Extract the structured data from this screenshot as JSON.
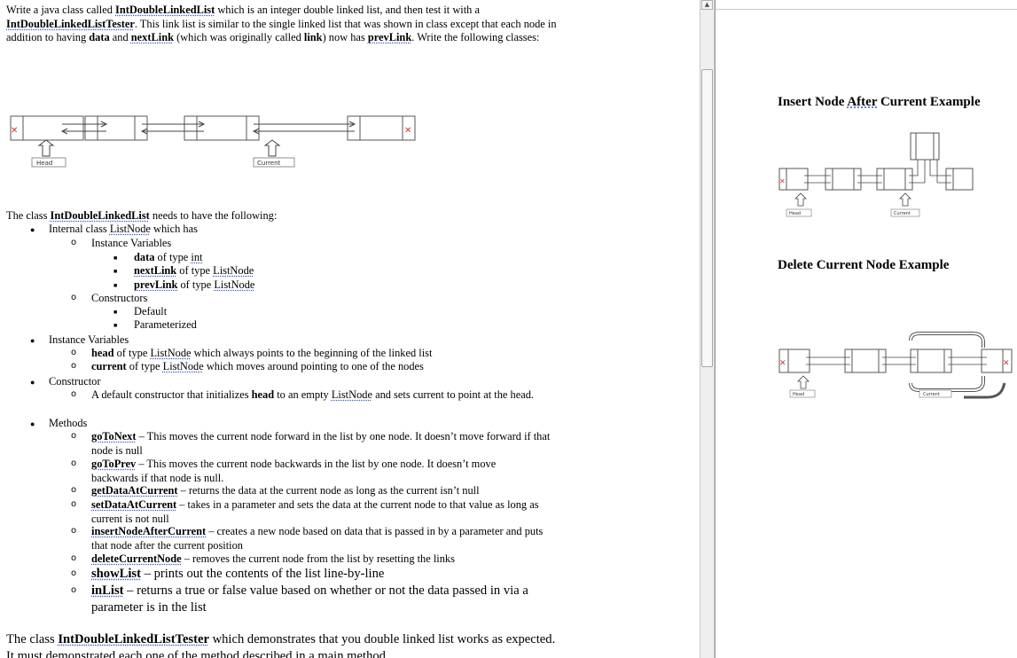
{
  "intro": {
    "part1": "Write a java class called ",
    "class1": "IntDoubleLinkedList",
    "part2": " which is an integer double linked list, and then test it with a ",
    "class2": "IntDoubleLinkedListTester",
    "part3": ".  This link list is similar to the single linked list that was shown in class except that each node in addition to having ",
    "data_word": "data",
    "and_word": " and ",
    "next_word": "nextLink",
    "part4": " (which was originally called ",
    "link_word": "link",
    "part5": ") now has ",
    "prev_word": "prevLink",
    "part6": ".  Write the following classes:"
  },
  "diagram_main": {
    "head_label": "Head",
    "current_label": "Current"
  },
  "section1": {
    "intro_a": "The class ",
    "class_name": "IntDoubleLinkedList",
    "intro_b": " needs to have the following:",
    "internal_a": "Internal class ",
    "internal_name": "ListNode",
    "internal_b": " which has",
    "instance_vars": "Instance Variables",
    "data_name": "data",
    "data_type_a": " of type ",
    "data_type": "int",
    "next_name": "nextLink",
    "next_type_a": " of type ",
    "next_type": "ListNode",
    "prev_name": "prevLink",
    "prev_type_a": " of type ",
    "prev_type": "ListNode",
    "constructors": "Constructors",
    "default": "Default",
    "parameterized": "Parameterized",
    "instance_vars2": "Instance Variables",
    "head_name": "head",
    "head_a": " of type ",
    "head_type": "ListNode",
    "head_b": " which always points to the beginning of the linked list",
    "current_name": "current",
    "current_a": " of type ",
    "current_type": "ListNode",
    "current_b": " which moves around pointing to one of the nodes",
    "constructor": "Constructor",
    "ctor_a": "A default constructor that initializes ",
    "ctor_head": "head",
    "ctor_b": " to an empty ",
    "ctor_listnode": "ListNode",
    "ctor_c": " and sets current to point at the head.",
    "methods": "Methods",
    "m1_name": "goToNext",
    "m1_desc": " – This moves the current node forward in the list by one node.  It doesn’t move forward if that node is null",
    "m2_name": "goToPrev",
    "m2_desc": " – This moves the current node backwards in the list by one node.  It doesn’t move backwards if that node is null.",
    "m3_name": "getDataAtCurrent",
    "m3_desc": " – returns the data at the current node as long as the current isn’t null",
    "m4_name": "setDataAtCurrent",
    "m4_desc": " – takes in a parameter and sets the data at the current node to that value as long as current is not null",
    "m5_name": "insertNodeAfterCurrent",
    "m5_desc": " – creates a new node based on data that is passed in by a parameter and puts that node after the current position",
    "m6_name": "deleteCurrentNode",
    "m6_desc": " – removes the current node from the list by resetting the links",
    "m7_name": "showList",
    "m7_desc": " – prints out the contents of the list line-by-line",
    "m8_name": "inList",
    "m8_desc": " – returns a true or false value based on whether or not the data passed in via a parameter is in the list"
  },
  "section2": {
    "a": "The class ",
    "name": "IntDoubleLinkedListTester",
    "b": " which demonstrates that you double linked list works as expected.  It must demonstrated each one of the method described in a main method."
  },
  "right_page": {
    "insert_title_a": "Insert Node ",
    "insert_title_after": "After",
    "insert_title_b": " Current Example",
    "insert_head": "Head",
    "insert_current": "Current",
    "delete_title": "Delete Current Node Example",
    "delete_head": "Head",
    "delete_current": "Current"
  },
  "colors": {
    "null_mark": "#d9302c",
    "link_underline": "#3355cc"
  },
  "icons": {
    "scroll_up": "triangle-up-icon"
  }
}
